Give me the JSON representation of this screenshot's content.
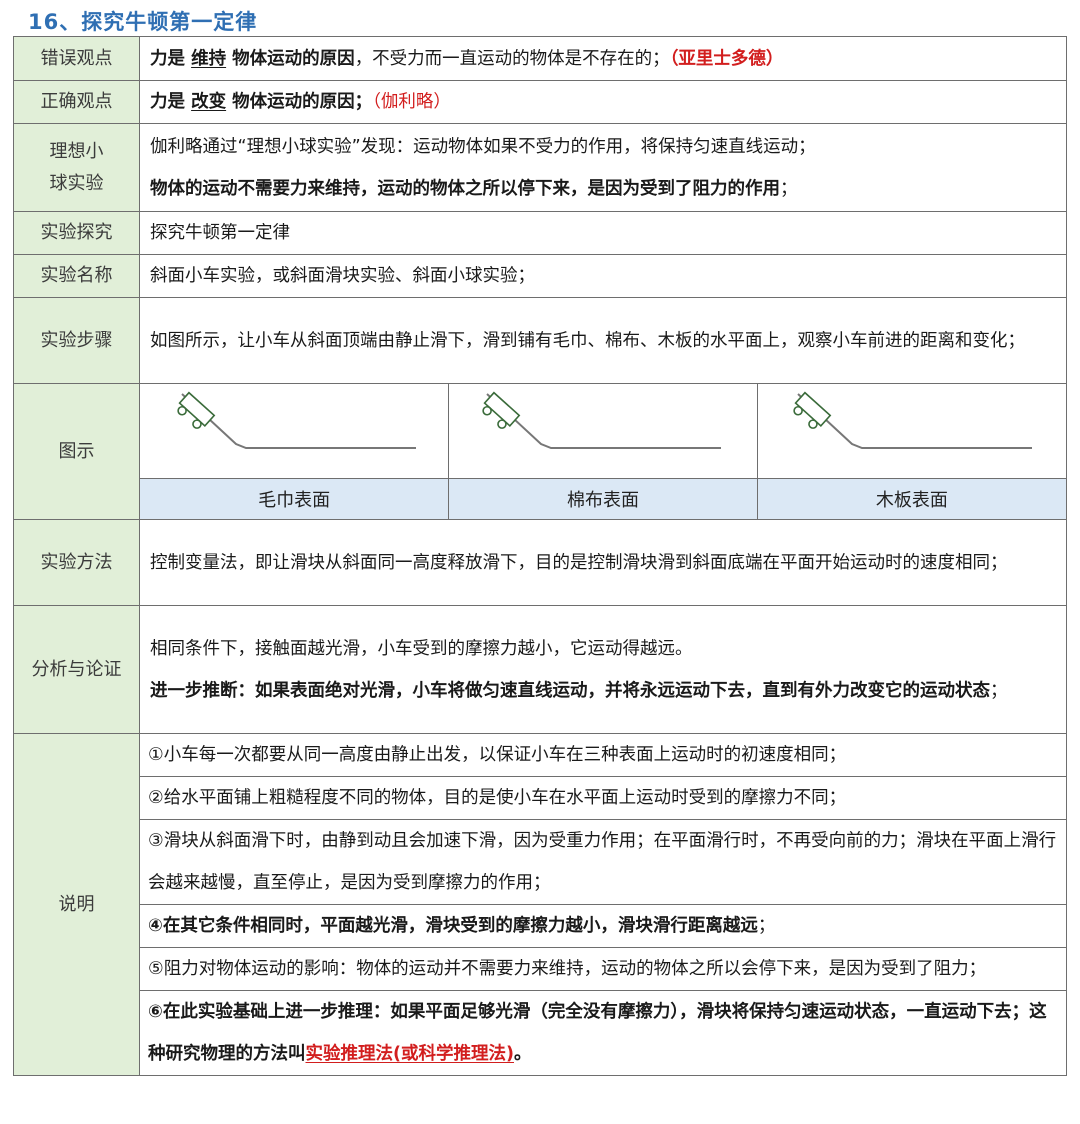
{
  "title": "16、探究牛顿第一定律",
  "rows": {
    "wrong": {
      "label": "错误观点",
      "p1": "力是 ",
      "p2": "维持",
      "p3": " 物体运动的原因",
      "p4": "，不受力而一直运动的物体是不存在的；",
      "p5": "（亚里士多德）"
    },
    "right": {
      "label": "正确观点",
      "p1": "力是 ",
      "p2": "改变",
      "p3": " 物体运动的原因；",
      "p4": "（伽利略）"
    },
    "ideal": {
      "label": "理想小球实验",
      "line1": "伽利略通过“理想小球实验”发现：运动物体如果不受力的作用，将保持匀速直线运动；",
      "line2": "物体的运动不需要力来维持，运动的物体之所以停下来，是因为受到了阻力的作用",
      "line2_end": "；"
    },
    "explore": {
      "label": "实验探究",
      "text": "探究牛顿第一定律"
    },
    "name": {
      "label": "实验名称",
      "text": "斜面小车实验，或斜面滑块实验、斜面小球实验；"
    },
    "steps": {
      "label": "实验步骤",
      "text": "如图所示，让小车从斜面顶端由静止滑下，滑到铺有毛巾、棉布、木板的水平面上，观察小车前进的距离和变化；"
    },
    "figure": {
      "label": "图示",
      "captions": [
        "毛巾表面",
        "棉布表面",
        "木板表面"
      ]
    },
    "method": {
      "label": "实验方法",
      "text": "控制变量法，即让滑块从斜面同一高度释放滑下，目的是控制滑块滑到斜面底端在平面开始运动时的速度相同；"
    },
    "analysis": {
      "label": "分析与论证",
      "line1": "相同条件下，接触面越光滑，小车受到的摩擦力越小，它运动得越远。",
      "line2": "进一步推断：如果表面绝对光滑，小车将做匀速直线运动，并将永远运动下去，直到有外力改变它的运动状态",
      "line2_end": "；"
    },
    "notes": {
      "label": "说明",
      "n1": "①小车每一次都要从同一高度由静止出发，以保证小车在三种表面上运动时的初速度相同；",
      "n2": "②给水平面铺上粗糙程度不同的物体，目的是使小车在水平面上运动时受到的摩擦力不同；",
      "n3": "③滑块从斜面滑下时，由静到动且会加速下滑，因为受重力作用；在平面滑行时，不再受向前的力；滑块在平面上滑行会越来越慢，直至停止，是因为受到摩擦力的作用；",
      "n4": "④在其它条件相同时，平面越光滑，滑块受到的摩擦力越小，滑块滑行距离越远",
      "n4_end": "；",
      "n5": "⑤阻力对物体运动的影响：物体的运动并不需要力来维持，运动的物体之所以会停下来，是因为受到了阻力；",
      "n6a": "⑥在此实验基础上进一步推理：如果平面足够光滑（完全没有摩擦力），滑块将保持匀速运动状态，一直运动下去；这种研究物理的方法叫",
      "n6b": "实验推理法(或科学推理法)",
      "n6c": "。"
    }
  },
  "colors": {
    "title": "#2f6fb3",
    "label_bg": "#e1efd8",
    "caption_bg": "#dbe8f5",
    "accent_red": "#d21e1e"
  },
  "icons": [
    "incline-cart-diagram"
  ]
}
